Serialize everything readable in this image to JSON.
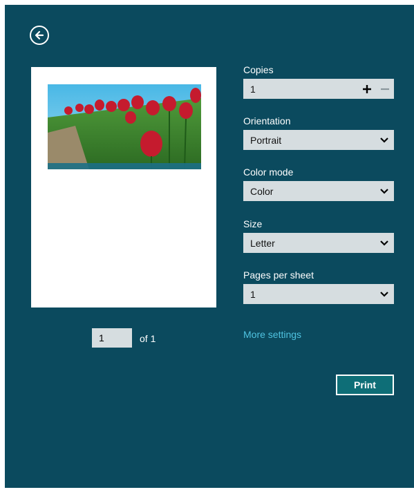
{
  "colors": {
    "background": "#0b4a5e",
    "field_bg": "#d6dde0",
    "link": "#4fc3e0",
    "print_bg": "#0e6e77"
  },
  "icons": {
    "back": "back-arrow-icon",
    "plus": "plus-icon",
    "minus": "minus-icon",
    "dropdown": "chevron-down-icon"
  },
  "preview": {
    "page_number": "1",
    "of_label": "of 1"
  },
  "settings": {
    "copies": {
      "label": "Copies",
      "value": "1"
    },
    "orientation": {
      "label": "Orientation",
      "value": "Portrait"
    },
    "color_mode": {
      "label": "Color mode",
      "value": "Color"
    },
    "size": {
      "label": "Size",
      "value": "Letter"
    },
    "pages_per_sheet": {
      "label": "Pages per sheet",
      "value": "1"
    }
  },
  "more_settings_label": "More settings",
  "print_label": "Print"
}
